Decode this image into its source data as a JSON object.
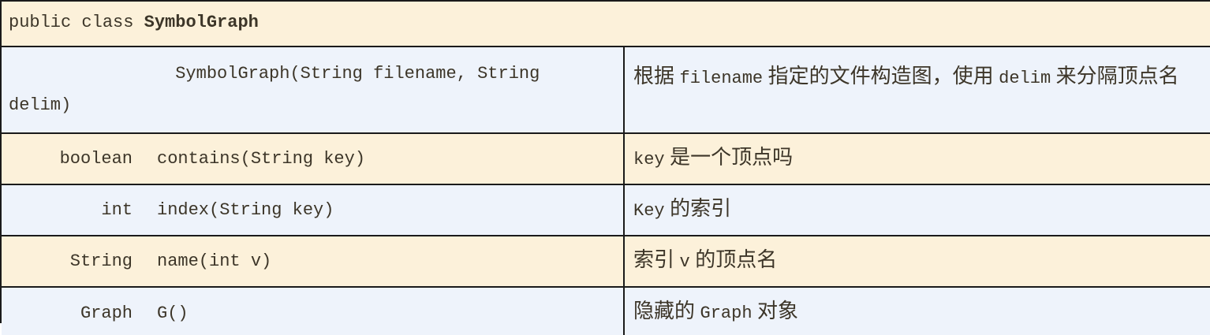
{
  "header": {
    "prefix": "public class ",
    "class_name": "SymbolGraph"
  },
  "rows": [
    {
      "return_type": "",
      "signature": "SymbolGraph(String filename, String delim)",
      "desc": {
        "p1": "根据 ",
        "c1": "filename",
        "p2": " 指定的文件构造图，使用 ",
        "c2": "delim",
        "p3": " 来分隔顶点名"
      }
    },
    {
      "return_type": "boolean",
      "signature": "contains(String key)",
      "desc": {
        "c1": "key",
        "p1": " 是一个顶点吗"
      }
    },
    {
      "return_type": "int",
      "signature": "index(String key)",
      "desc": {
        "c1": "Key",
        "p1": " 的索引"
      }
    },
    {
      "return_type": "String",
      "signature": "name(int v)",
      "desc": {
        "p1": "索引 ",
        "c1": "v",
        "p2": " 的顶点名"
      }
    },
    {
      "return_type": "Graph",
      "signature": "G()",
      "desc": {
        "p1": "隐藏的 ",
        "c1": "Graph",
        "p2": " 对象"
      }
    }
  ]
}
